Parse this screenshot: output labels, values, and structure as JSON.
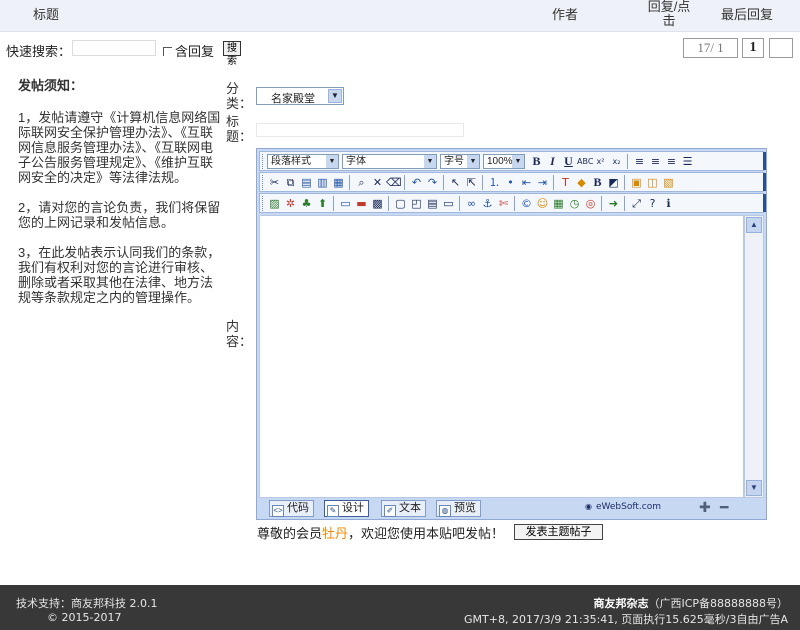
{
  "list_header": {
    "title": "标题",
    "author": "作者",
    "reply_click": "回复/点击",
    "last_reply": "最后回复"
  },
  "search": {
    "label": "快速搜索：",
    "input_value": "",
    "include_reply": "含回复",
    "button": "搜索"
  },
  "pager": {
    "info": "17/ 1",
    "current": "1",
    "next": ""
  },
  "notice": {
    "heading": "发帖须知：",
    "items": [
      "1，发帖请遵守《计算机信息网络国际联网安全保护管理办法》、《互联网信息服务管理办法》、《互联网电子公告服务管理规定》、《维护互联网安全的决定》等法律法规。",
      "2，请对您的言论负责，我们将保留您的上网记录和发帖信息。",
      "3，在此发帖表示认同我们的条款，我们有权利对您的言论进行审核、删除或者采取其他在法律、地方法规等条款规定之内的管理操作。"
    ]
  },
  "form": {
    "category_label": "分类：",
    "category_value": "名家殿堂",
    "title_label": "标题：",
    "title_value": "",
    "content_label": "内容："
  },
  "editor": {
    "style_select": "段落样式",
    "font_select": "字体",
    "size_select": "字号",
    "zoom_select": "100%",
    "tabs": {
      "code": "代码",
      "design": "设计",
      "text": "文本",
      "preview": "预览"
    },
    "brand": "eWebSoft.com"
  },
  "post": {
    "welcome_prefix": "尊敬的会员",
    "member_name": "牡丹",
    "welcome_suffix": "，欢迎您使用本贴吧发帖！",
    "submit": "发表主题帖子"
  },
  "footer": {
    "support": "技术支持：商友邦科技 2.0.1",
    "copyright": "© 2015-2017",
    "site_name": "商友邦杂志",
    "icp": "（广西ICP备88888888号）",
    "stats": "GMT+8, 2017/3/9 21:35:41, 页面执行15.625毫秒/3自由广告A"
  },
  "colors": {
    "header_bg": "#eef2f8",
    "editor_frame": "#c6d8f2",
    "member_highlight": "#f08a00",
    "footer_bg": "#383838"
  }
}
